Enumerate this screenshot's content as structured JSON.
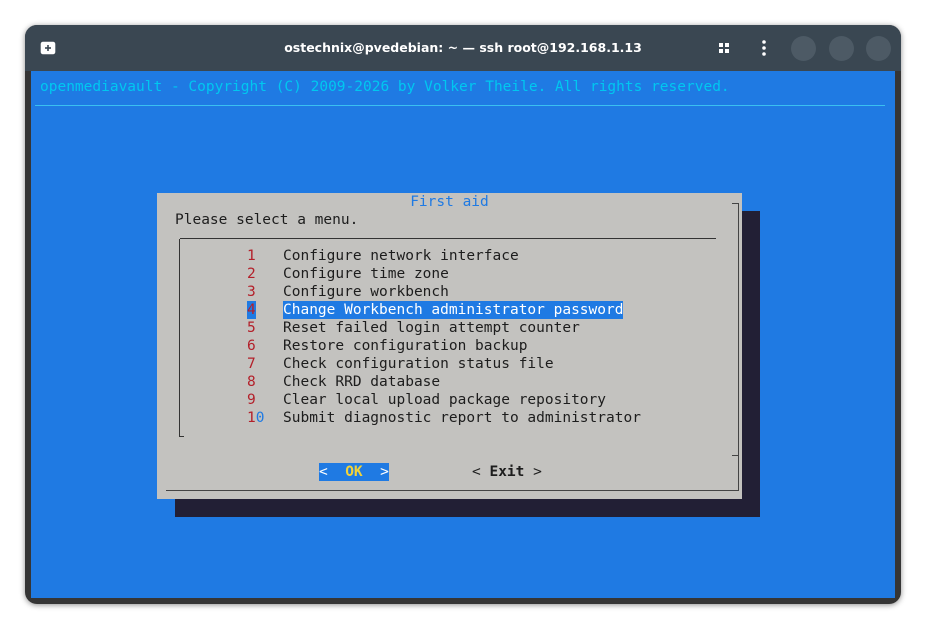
{
  "window": {
    "title": "ostechnix@pvedebian: ~ — ssh root@192.168.1.13",
    "icons": [
      "new-tab-icon",
      "grid-icon",
      "kebab-menu-icon"
    ]
  },
  "terminal": {
    "banner": "openmediavault - Copyright (C) 2009-2026 by Volker Theile. All rights reserved."
  },
  "dialog": {
    "title": "First aid",
    "prompt": "Please select a menu.",
    "selected_index": 3,
    "items": [
      {
        "num": "1",
        "label": "Configure network interface"
      },
      {
        "num": "2",
        "label": "Configure time zone"
      },
      {
        "num": "3",
        "label": "Configure workbench"
      },
      {
        "num": "4",
        "label": "Change Workbench administrator password"
      },
      {
        "num": "5",
        "label": "Reset failed login attempt counter"
      },
      {
        "num": "6",
        "label": "Restore configuration backup"
      },
      {
        "num": "7",
        "label": "Check configuration status file"
      },
      {
        "num": "8",
        "label": "Check RRD database"
      },
      {
        "num": "9",
        "label": "Clear local upload package repository"
      },
      {
        "num": "10",
        "label": "Submit diagnostic report to administrator"
      }
    ],
    "ok": {
      "open": "<  ",
      "key": "OK",
      "close": "  >"
    },
    "exit": {
      "open": "< ",
      "key": "Exit",
      "close": " >"
    }
  },
  "colors": {
    "terminal_bg": "#1f7ae3",
    "dialog_bg": "#c3c2bf",
    "number_red": "#b3202a",
    "banner_cyan": "#00c8f0",
    "ok_key_yellow": "#f2d33a",
    "titlebar": "#3a4752"
  }
}
